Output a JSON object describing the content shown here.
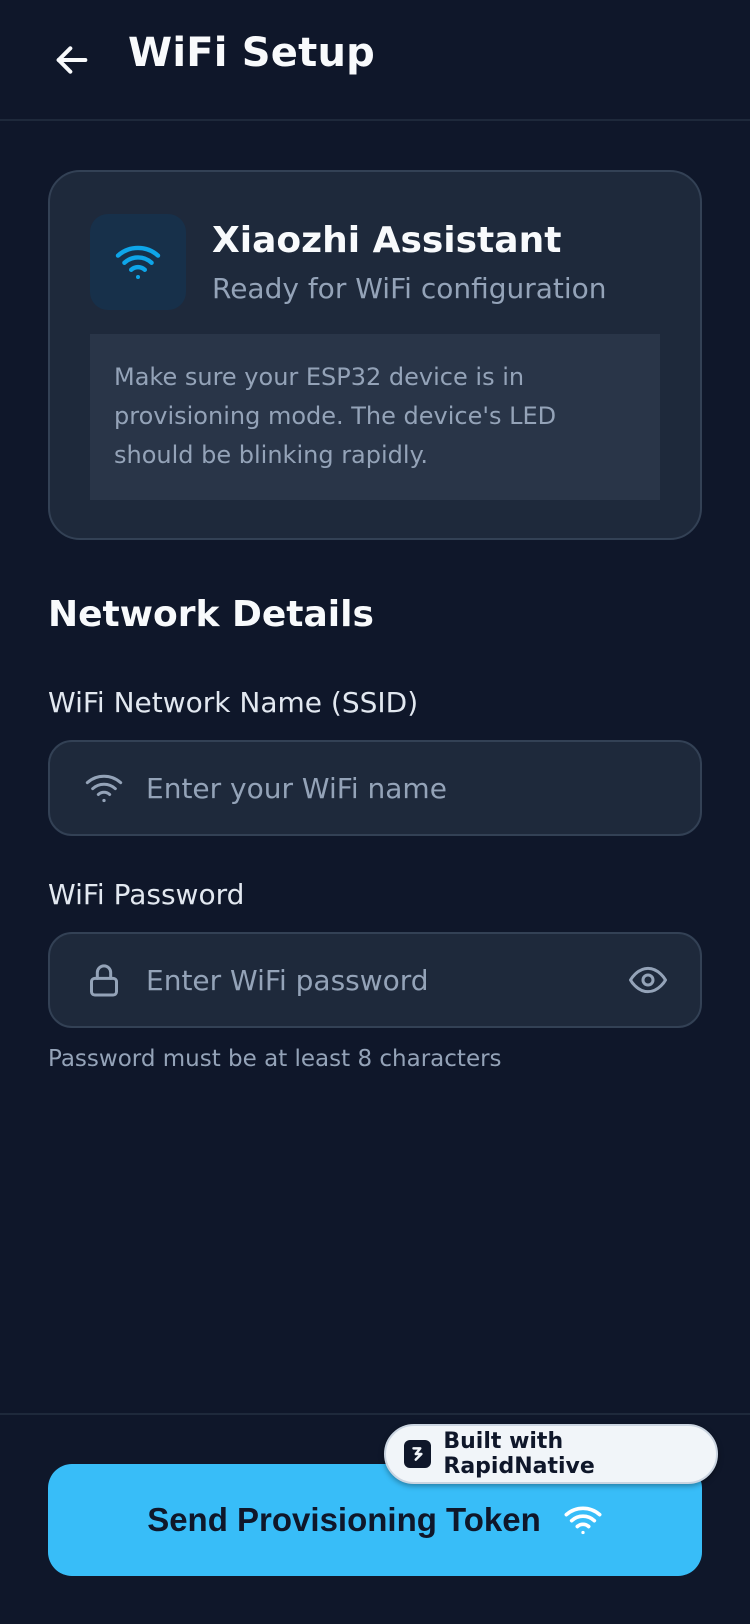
{
  "header": {
    "title": "WiFi Setup",
    "back_icon": "arrow-left-icon"
  },
  "device": {
    "name": "Xiaozhi Assistant",
    "status": "Ready for WiFi configuration",
    "icon": "wifi-icon",
    "notice": "Make sure your ESP32 device is in provisioning mode. The device's LED should be blinking rapidly."
  },
  "network": {
    "section_title": "Network Details",
    "ssid": {
      "label": "WiFi Network Name (SSID)",
      "value": "",
      "placeholder": "Enter your WiFi name",
      "icon": "wifi-icon"
    },
    "password": {
      "label": "WiFi Password",
      "value": "",
      "placeholder": "Enter WiFi password",
      "icon": "lock-icon",
      "toggle_icon": "eye-icon",
      "hint": "Password must be at least 8 characters"
    }
  },
  "footer": {
    "submit_label": "Send Provisioning Token",
    "submit_icon": "wifi-icon",
    "badge_text": "Built with RapidNative",
    "badge_icon": "rapidnative-logo-icon"
  },
  "colors": {
    "background": "#0f172a",
    "card": "#1e293b",
    "accent": "#38bdf8",
    "muted_text": "#94a3b8"
  }
}
